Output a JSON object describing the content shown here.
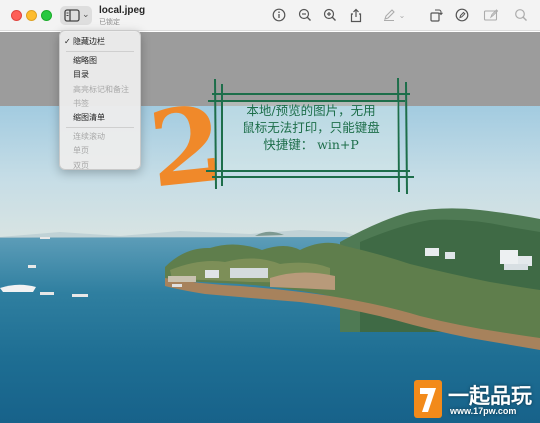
{
  "window": {
    "file_name": "local.jpeg",
    "status": "已锁定"
  },
  "toolbar": {
    "icons": [
      "info-icon",
      "zoom-out-icon",
      "zoom-in-icon",
      "share-icon",
      "markup-pen-icon",
      "rotate-icon",
      "annotate-icon",
      "edit-frame-icon",
      "search-icon"
    ]
  },
  "menu": {
    "items": [
      {
        "label": "隐藏边栏",
        "checked": true,
        "enabled": true
      },
      {
        "label": "缩略图",
        "checked": false,
        "enabled": true
      },
      {
        "label": "目录",
        "checked": false,
        "enabled": true
      },
      {
        "label": "高亮标记和备注",
        "checked": false,
        "enabled": false
      },
      {
        "label": "书签",
        "checked": false,
        "enabled": false
      },
      {
        "label": "缩图清单",
        "checked": false,
        "enabled": true
      },
      {
        "label": "连续滚动",
        "checked": false,
        "enabled": false
      },
      {
        "label": "单页",
        "checked": false,
        "enabled": false
      },
      {
        "label": "双页",
        "checked": false,
        "enabled": false
      }
    ]
  },
  "annotation": {
    "number": "2",
    "line1": "本地/预览的图片，无用",
    "line2": "鼠标无法打印，只能键盘",
    "line3": "快捷键： win+P",
    "color": "#1d6e4a",
    "number_color": "#f0892a"
  },
  "watermark": {
    "name": "一起品玩",
    "url": "www.17pw.com"
  }
}
